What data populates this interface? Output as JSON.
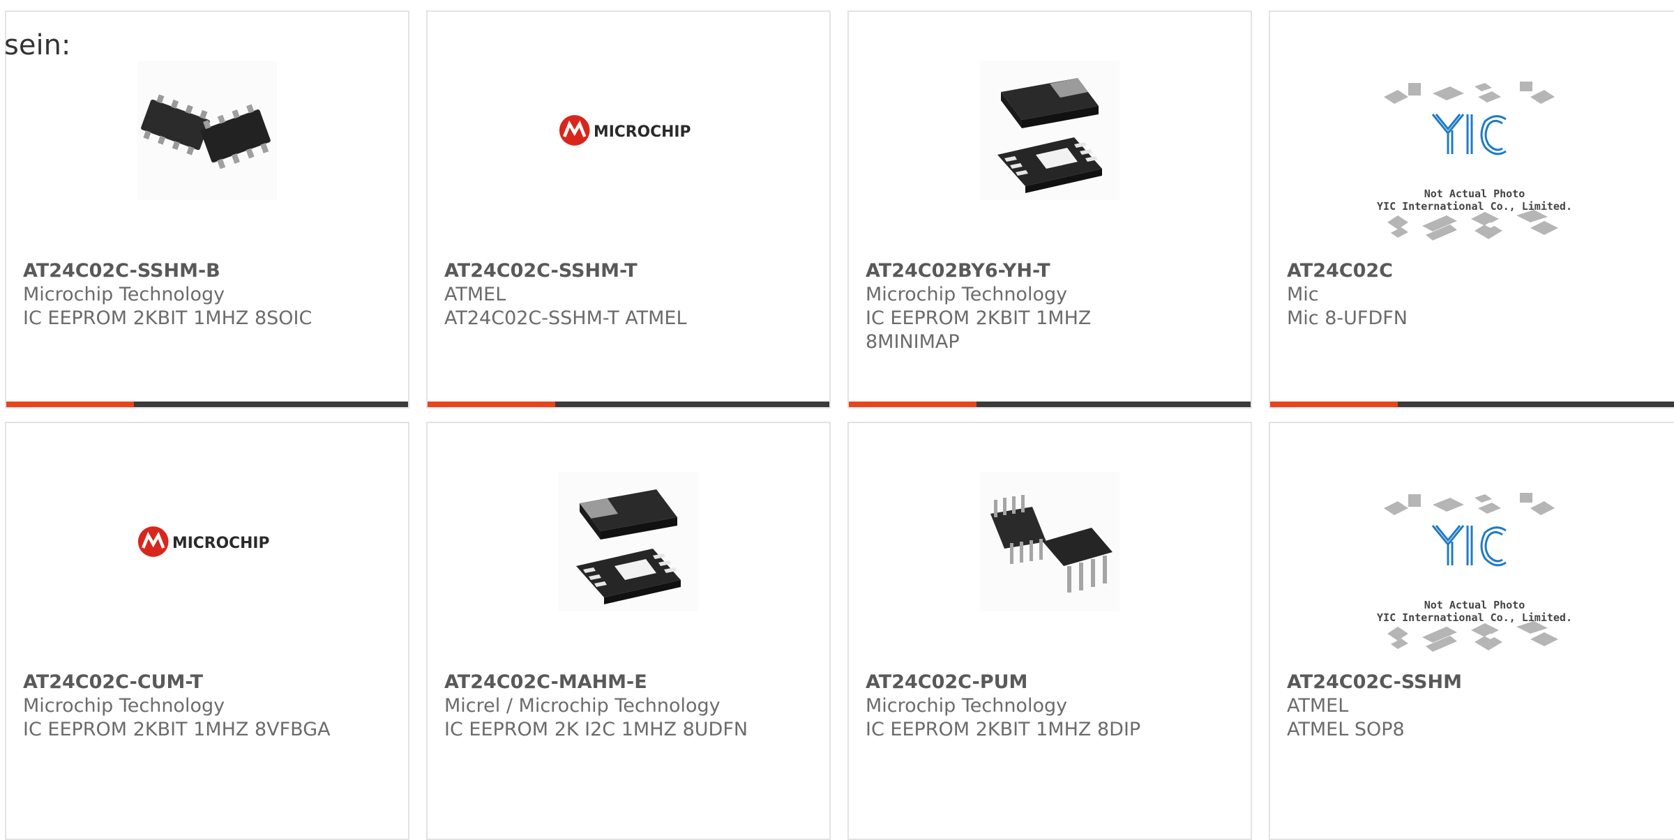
{
  "intro_text": "sein:",
  "colors": {
    "accent": "#e8441c",
    "bar": "#3a3a3a",
    "microchip_red": "#d9261c"
  },
  "products": [
    {
      "part": "AT24C02C-SSHM-B",
      "maker": "Microchip Technology",
      "desc": "IC EEPROM 2KBIT 1MHZ 8SOIC",
      "image": "soic-chips"
    },
    {
      "part": "AT24C02C-SSHM-T",
      "maker": "ATMEL",
      "desc": "AT24C02C-SSHM-T  ATMEL",
      "image": "microchip-logo",
      "logo_text": "MICROCHIP"
    },
    {
      "part": "AT24C02BY6-YH-T",
      "maker": "Microchip Technology",
      "desc": "IC EEPROM 2KBIT 1MHZ 8MINIMAP",
      "image": "dfn-chip"
    },
    {
      "part": "AT24C02C",
      "maker": "Mic",
      "desc": "Mic 8-UFDFN",
      "image": "yic-placeholder",
      "caption1": "Not Actual Photo",
      "caption2": "YIC International Co., Limited."
    },
    {
      "part": "AT24C02C-CUM-T",
      "maker": "Microchip Technology",
      "desc": "IC EEPROM 2KBIT 1MHZ 8VFBGA",
      "image": "microchip-logo",
      "logo_text": "MICROCHIP"
    },
    {
      "part": "AT24C02C-MAHM-E",
      "maker": "Micrel / Microchip Technology",
      "desc": "IC EEPROM 2K I2C 1MHZ 8UDFN",
      "image": "dfn-chip"
    },
    {
      "part": "AT24C02C-PUM",
      "maker": "Microchip Technology",
      "desc": "IC EEPROM 2KBIT 1MHZ 8DIP",
      "image": "dip-chips"
    },
    {
      "part": "AT24C02C-SSHM",
      "maker": "ATMEL",
      "desc": "ATMEL SOP8",
      "image": "yic-placeholder",
      "caption1": "Not Actual Photo",
      "caption2": "YIC International Co., Limited."
    }
  ]
}
